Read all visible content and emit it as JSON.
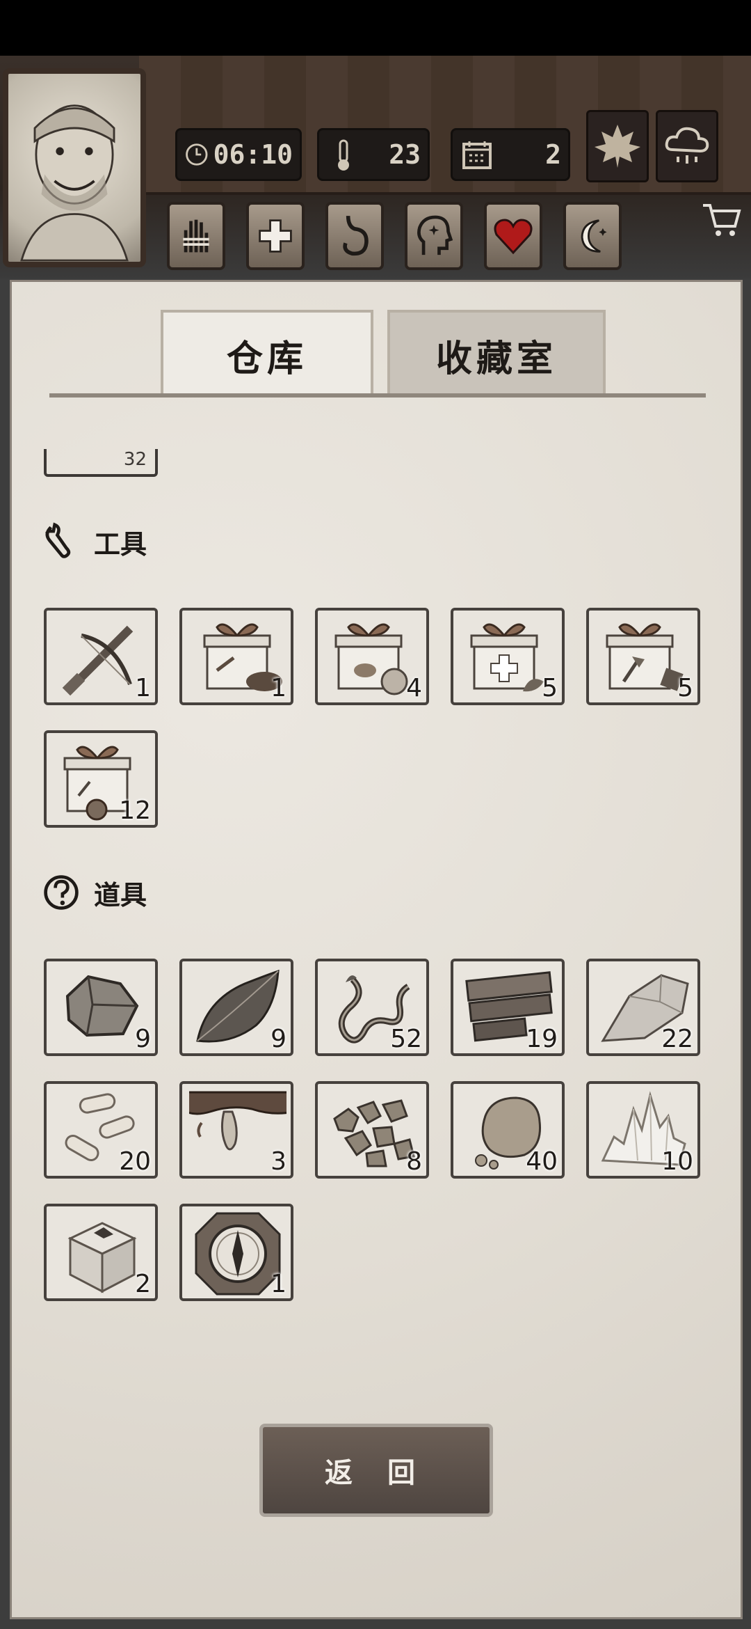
{
  "hud": {
    "time": "06:10",
    "temperature": "23",
    "day": "2",
    "season_icon": "maple-leaf-icon",
    "weather_icon": "rain-cloud-icon",
    "shop_icon": "cart-icon",
    "needs": [
      {
        "icon": "bandaged-hand-icon"
      },
      {
        "icon": "medical-cross-icon"
      },
      {
        "icon": "stomach-icon"
      },
      {
        "icon": "head-sparkle-icon"
      },
      {
        "icon": "heart-icon",
        "color": "#b01a1a"
      },
      {
        "icon": "moon-icon"
      }
    ]
  },
  "tabs": [
    {
      "label": "仓库",
      "active": true
    },
    {
      "label": "收藏室",
      "active": false
    }
  ],
  "partial_item_qty": "32",
  "sections": {
    "tools": {
      "title": "工具",
      "icon": "wrench-icon",
      "items": [
        {
          "icon": "crossbow-icon",
          "qty": "1"
        },
        {
          "icon": "gift-box-wood-icon",
          "qty": "1"
        },
        {
          "icon": "gift-box-food-icon",
          "qty": "4"
        },
        {
          "icon": "gift-box-medical-icon",
          "qty": "5"
        },
        {
          "icon": "gift-box-axe-icon",
          "qty": "5"
        },
        {
          "icon": "gift-box-logs-icon",
          "qty": "12"
        }
      ]
    },
    "props": {
      "title": "道具",
      "icon": "question-icon",
      "items": [
        {
          "icon": "stone-icon",
          "qty": "9"
        },
        {
          "icon": "leaf-icon",
          "qty": "9"
        },
        {
          "icon": "vine-icon",
          "qty": "52"
        },
        {
          "icon": "planks-icon",
          "qty": "19"
        },
        {
          "icon": "flint-icon",
          "qty": "22"
        },
        {
          "icon": "bone-pieces-icon",
          "qty": "20"
        },
        {
          "icon": "resin-icon",
          "qty": "3"
        },
        {
          "icon": "ore-nuggets-icon",
          "qty": "8"
        },
        {
          "icon": "clay-lump-icon",
          "qty": "40"
        },
        {
          "icon": "crystal-icon",
          "qty": "10"
        },
        {
          "icon": "crate-icon",
          "qty": "2"
        },
        {
          "icon": "compass-icon",
          "qty": "1"
        }
      ]
    }
  },
  "back_button": "返 回"
}
